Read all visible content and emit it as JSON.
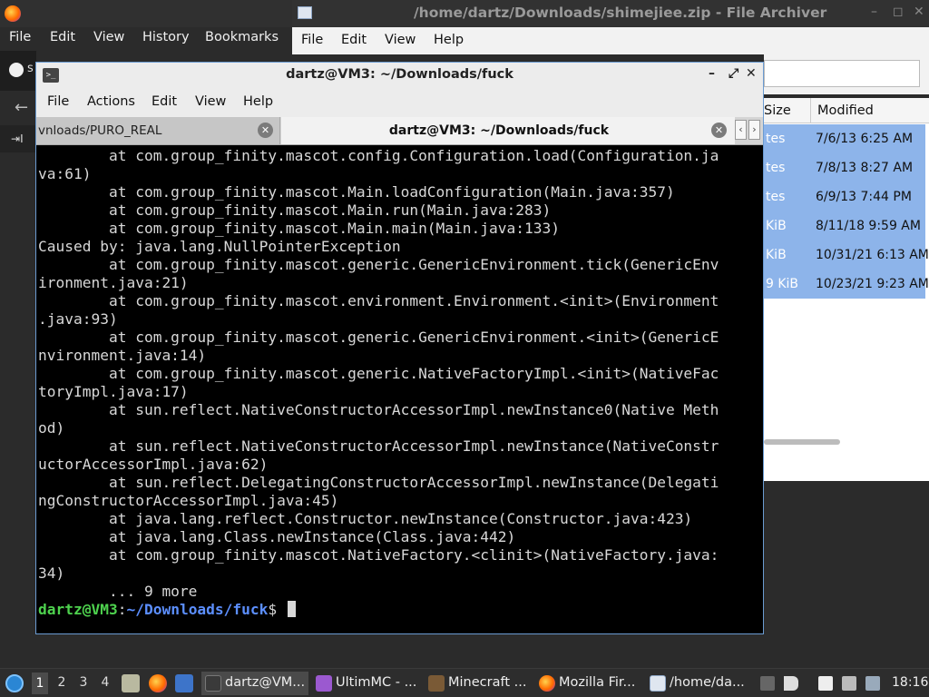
{
  "firefox": {
    "menu": [
      "File",
      "Edit",
      "View",
      "History",
      "Bookmarks"
    ],
    "tab_label_partial": "s",
    "sidebar_partial": "I"
  },
  "archiver": {
    "title": "/home/dartz/Downloads/shimejiee.zip - File Archiver",
    "menu": [
      "File",
      "Edit",
      "View",
      "Help"
    ],
    "columns": {
      "size": "Size",
      "modified": "Modified"
    },
    "rows": [
      {
        "size": "tes",
        "modified": "7/6/13 6:25 AM"
      },
      {
        "size": "tes",
        "modified": "7/8/13 8:27 AM"
      },
      {
        "size": "tes",
        "modified": "6/9/13 7:44 PM"
      },
      {
        "size": "KiB",
        "modified": "8/11/18 9:59 AM"
      },
      {
        "size": "KiB",
        "modified": "10/31/21 6:13 AM"
      },
      {
        "size": "9 KiB",
        "modified": "10/23/21 9:23 AM"
      }
    ]
  },
  "terminal": {
    "title": "dartz@VM3: ~/Downloads/fuck",
    "menu": [
      "File",
      "Actions",
      "Edit",
      "View",
      "Help"
    ],
    "tabs": [
      {
        "label": "vnloads/PURO_REAL"
      },
      {
        "label": "dartz@VM3: ~/Downloads/fuck"
      }
    ],
    "output": [
      "        at com.group_finity.mascot.config.Configuration.load(Configuration.ja",
      "va:61)",
      "        at com.group_finity.mascot.Main.loadConfiguration(Main.java:357)",
      "        at com.group_finity.mascot.Main.run(Main.java:283)",
      "        at com.group_finity.mascot.Main.main(Main.java:133)",
      "Caused by: java.lang.NullPointerException",
      "        at com.group_finity.mascot.generic.GenericEnvironment.tick(GenericEnv",
      "ironment.java:21)",
      "        at com.group_finity.mascot.environment.Environment.<init>(Environment",
      ".java:93)",
      "        at com.group_finity.mascot.generic.GenericEnvironment.<init>(GenericE",
      "nvironment.java:14)",
      "        at com.group_finity.mascot.generic.NativeFactoryImpl.<init>(NativeFac",
      "toryImpl.java:17)",
      "        at sun.reflect.NativeConstructorAccessorImpl.newInstance0(Native Meth",
      "od)",
      "        at sun.reflect.NativeConstructorAccessorImpl.newInstance(NativeConstr",
      "uctorAccessorImpl.java:62)",
      "        at sun.reflect.DelegatingConstructorAccessorImpl.newInstance(Delegati",
      "ngConstructorAccessorImpl.java:45)",
      "        at java.lang.reflect.Constructor.newInstance(Constructor.java:423)",
      "        at java.lang.Class.newInstance(Class.java:442)",
      "        at com.group_finity.mascot.NativeFactory.<clinit>(NativeFactory.java:",
      "34)",
      "        ... 9 more"
    ],
    "prompt": {
      "user": "dartz@VM3",
      "colon": ":",
      "path": "~/Downloads/fuck",
      "dollar": "$ "
    }
  },
  "taskbar": {
    "workspaces": [
      "1",
      "2",
      "3",
      "4"
    ],
    "tasks": [
      {
        "label": "dartz@VM...",
        "icon": "terminal-icon",
        "color": "#3a3a3a"
      },
      {
        "label": "UltimMC - ...",
        "icon": "ultimmc-icon",
        "color": "#9b59d0"
      },
      {
        "label": "Minecraft ...",
        "icon": "minecraft-icon",
        "color": "#7a5a36"
      },
      {
        "label": "Mozilla Fir...",
        "icon": "firefox-icon",
        "color": "#ff7a1a"
      },
      {
        "label": "/home/da...",
        "icon": "archive-icon",
        "color": "#dfe6f0"
      }
    ],
    "clock": "18:16"
  }
}
